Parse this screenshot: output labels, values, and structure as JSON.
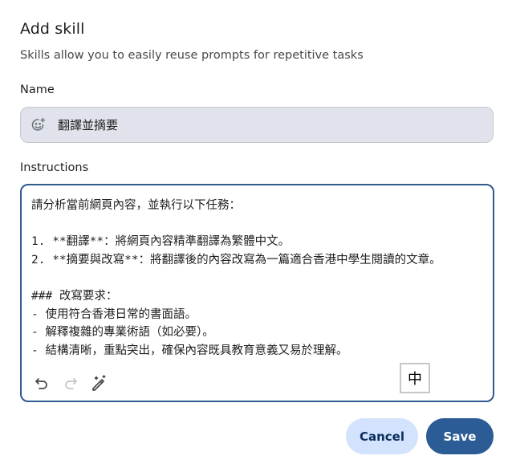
{
  "dialog": {
    "title": "Add skill",
    "subtitle": "Skills allow you to easily reuse prompts for repetitive tasks"
  },
  "name_field": {
    "label": "Name",
    "value": "翻譯並摘要",
    "icon": "emoji-add-icon"
  },
  "instructions": {
    "label": "Instructions",
    "value": "請分析當前網頁內容，並執行以下任務：\n\n1. **翻譯**：將網頁內容精準翻譯為繁體中文。\n2. **摘要與改寫**：將翻譯後的內容改寫為一篇適合香港中學生閱讀的文章。\n\n### 改寫要求：\n- 使用符合香港日常的書面語。\n- 解釋複雜的專業術語（如必要）。\n- 結構清晰，重點突出，確保內容既具教育意義又易於理解。",
    "toolbar": {
      "undo_icon": "undo-icon",
      "redo_icon": "redo-icon",
      "magic_icon": "magic-pen-icon"
    },
    "ime_indicator": "中"
  },
  "actions": {
    "cancel_label": "Cancel",
    "save_label": "Save"
  },
  "colors": {
    "accent": "#2b5c95",
    "secondary_button": "#d3e3fd",
    "input_fill": "#e0e3eb"
  }
}
